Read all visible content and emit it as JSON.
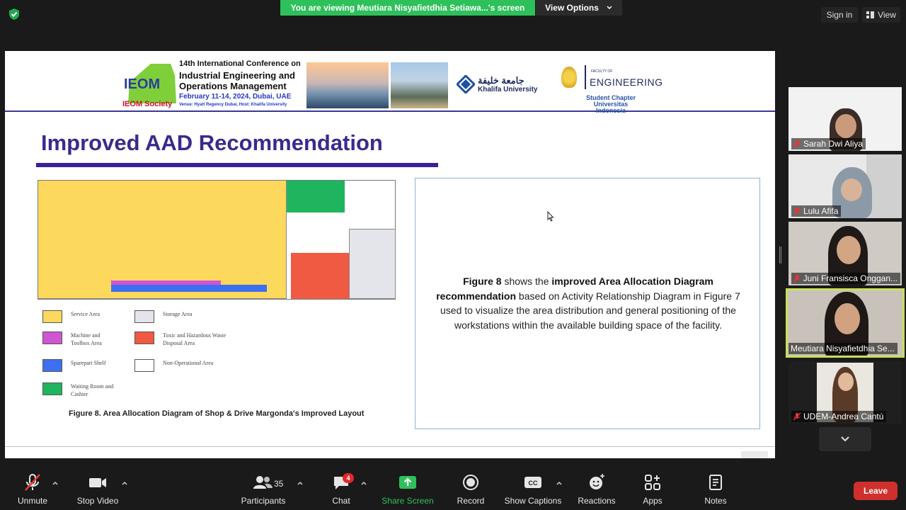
{
  "top_bar": {
    "banner_text": "You are viewing Meutiara Nisyafietdhia Setiawa...'s screen",
    "view_options": "View Options",
    "sign_in": "Sign in",
    "view": "View"
  },
  "slide": {
    "header": {
      "ieom_logo_text": "IEOM",
      "ieom_society": "IEOM Society",
      "conference_line1": "14th International Conference on",
      "conference_line2": "Industrial Engineering and Operations Management",
      "conference_date": "February 11-14, 2024, Dubai, UAE",
      "conference_venue": "Venue: Hyatt Regency Dubai, Host: Khalifa University",
      "ku_arabic": "جامعة خليفة",
      "ku_english": "Khalifa University",
      "ui_faculty": "FACULTY OF",
      "ui_engineering": "ENGINEERING",
      "ui_student_chapter": "Student Chapter Universitas Indonesia"
    },
    "title": "Improved AAD Recommendation",
    "legend": [
      {
        "label": "Service Area",
        "color": "#fcd85c"
      },
      {
        "label": "Machine and Toolbox Area",
        "color": "#cf55d2"
      },
      {
        "label": "Sparepart Shelf",
        "color": "#3d6ff0"
      },
      {
        "label": "Waiting Room and Cashier",
        "color": "#1fb55f"
      },
      {
        "label": "Storage Area",
        "color": "#e4e5ea"
      },
      {
        "label": "Toxic and Hazardous Waste Disposal Area",
        "color": "#f05a42"
      },
      {
        "label": "Non-Operational Area",
        "color": "#ffffff"
      }
    ],
    "figure_caption": "Figure 8. Area Allocation Diagram of Shop & Drive Margonda's Improved Layout",
    "description": {
      "part1": "Figure 8",
      "part2": " shows the ",
      "part3": "improved Area Allocation Diagram recommendation",
      "part4": " based on Activity Relationship Diagram in Figure 7 used to visualize the area distribution and general positioning of the workstations within the available building space of the facility."
    }
  },
  "participants": [
    {
      "name": "Sarah Dwi Aliya"
    },
    {
      "name": "Lulu Afifa"
    },
    {
      "name": "Juni Fransisca Onggan..."
    },
    {
      "name": "Meutiara Nisyafietdhia Se..."
    },
    {
      "name": "UDEM-Andrea Cantú"
    }
  ],
  "toolbar": {
    "unmute": "Unmute",
    "stop_video": "Stop Video",
    "participants": "Participants",
    "participants_count": "35",
    "chat": "Chat",
    "chat_badge": "4",
    "share_screen": "Share Screen",
    "record": "Record",
    "show_captions": "Show Captions",
    "reactions": "Reactions",
    "apps": "Apps",
    "notes": "Notes",
    "leave": "Leave"
  },
  "colors": {
    "share_green": "#2ec05a",
    "leave_red": "#d0302d",
    "active_speaker": "#c8e05a"
  }
}
